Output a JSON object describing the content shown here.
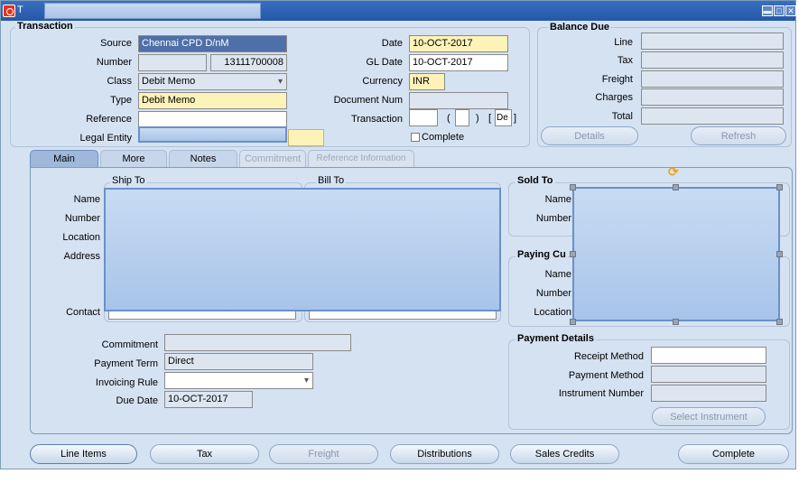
{
  "window": {
    "title_letter": "T",
    "min_icon": "minimize-icon",
    "max_icon": "maximize-icon",
    "close_icon": "close-icon"
  },
  "transaction": {
    "group_title": "Transaction",
    "source_label": "Source",
    "source_value": "Chennai CPD D/nM",
    "number_label": "Number",
    "number_value": "13111700008",
    "class_label": "Class",
    "class_value": "Debit Memo",
    "type_label": "Type",
    "type_value": "Debit Memo",
    "reference_label": "Reference",
    "reference_value": "",
    "legal_entity_label": "Legal Entity",
    "date_label": "Date",
    "date_value": "10-OCT-2017",
    "gl_date_label": "GL Date",
    "gl_date_value": "10-OCT-2017",
    "currency_label": "Currency",
    "currency_value": "INR",
    "document_num_label": "Document Num",
    "document_num_value": "",
    "transaction_label": "Transaction",
    "paren_open": "(",
    "paren_close": ")",
    "bracket_open": "[",
    "bracket_value": "De",
    "bracket_close": "]",
    "complete_label": "Complete"
  },
  "balance_due": {
    "title": "Balance Due",
    "line_label": "Line",
    "tax_label": "Tax",
    "freight_label": "Freight",
    "charges_label": "Charges",
    "total_label": "Total",
    "details_button": "Details",
    "refresh_button": "Refresh"
  },
  "tabs": [
    "Main",
    "More",
    "Notes",
    "Commitment",
    "Reference Information"
  ],
  "main": {
    "ship_to_title": "Ship To",
    "bill_to_title": "Bill To",
    "name_label": "Name",
    "number_label": "Number",
    "location_label": "Location",
    "address_label": "Address",
    "contact_label": "Contact",
    "sold_to_title": "Sold To",
    "sold_name_label": "Name",
    "sold_number_label": "Number",
    "paying_title": "Paying Cu",
    "paying_name_label": "Name",
    "paying_number_label": "Number",
    "paying_location_label": "Location",
    "commitment_label": "Commitment",
    "commitment_value": "",
    "payment_term_label": "Payment Term",
    "payment_term_value": "Direct",
    "invoicing_rule_label": "Invoicing Rule",
    "invoicing_rule_value": "",
    "due_date_label": "Due Date",
    "due_date_value": "10-OCT-2017",
    "payment_details_title": "Payment Details",
    "receipt_method_label": "Receipt Method",
    "payment_method_label": "Payment Method",
    "instrument_number_label": "Instrument Number",
    "select_instrument_button": "Select Instrument"
  },
  "bottom_buttons": [
    "Line Items",
    "Tax",
    "Freight",
    "Distributions",
    "Sales Credits",
    "Complete"
  ],
  "colors": {
    "title_bar": "#2457a8",
    "required_field": "#fdf3b9",
    "selection": "#a8c4e9",
    "window_bg": "#d5e2f2"
  }
}
